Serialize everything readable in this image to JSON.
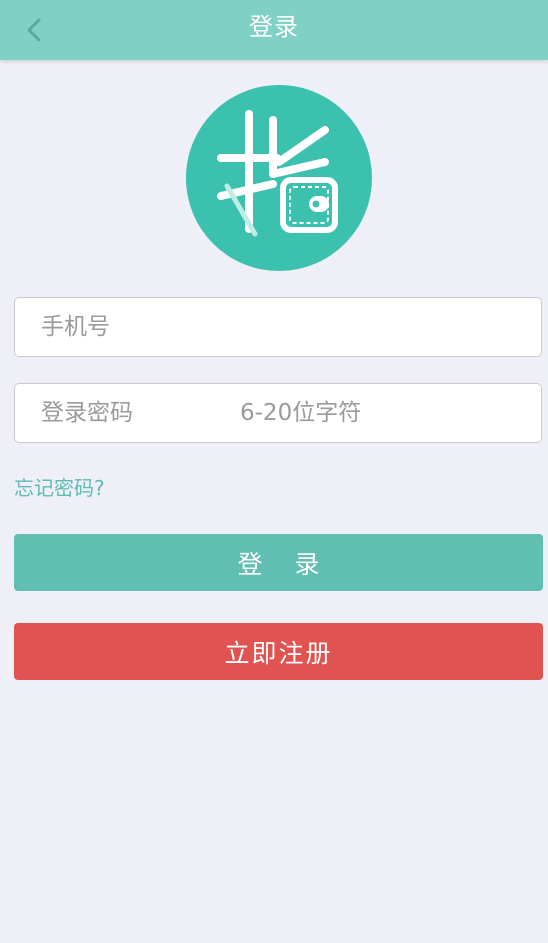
{
  "header": {
    "title": "登录",
    "back_icon": "chevron-left-icon"
  },
  "logo": {
    "icon": "finger-wallet-logo",
    "bg_color": "#3cc1ae"
  },
  "form": {
    "phone_placeholder": "手机号",
    "password_placeholder": "登录密码",
    "password_hint": "6-20位字符",
    "forgot_label": "忘记密码?"
  },
  "buttons": {
    "login_label": "登 录",
    "register_label": "立即注册"
  },
  "colors": {
    "header": "#7fd1c6",
    "accent": "#60beb3",
    "danger": "#e05350",
    "background": "#efeff7"
  }
}
